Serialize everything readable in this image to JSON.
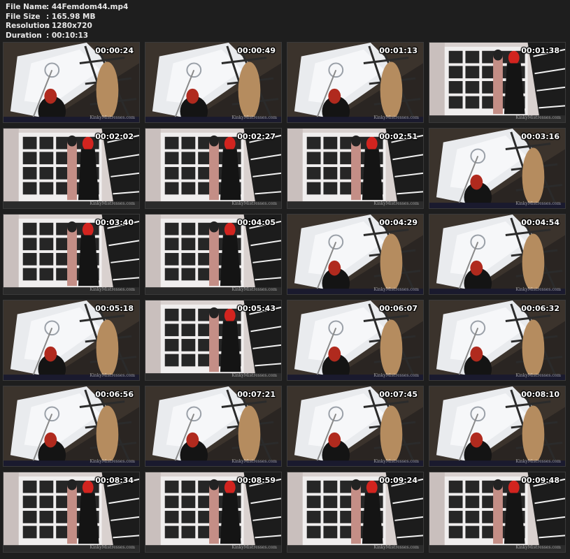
{
  "file_info": [
    {
      "label": "File Name",
      "value": ":  44Femdom44.mp4"
    },
    {
      "label": "File Size",
      "value": ":  165.98 MB"
    },
    {
      "label": "Resolution",
      "value": ":  1280x720"
    },
    {
      "label": "Duration",
      "value": ":  00:10:13"
    }
  ],
  "watermark": "KinkyMistresses.com",
  "thumbnails": [
    {
      "time": "00:00:24",
      "scene": "low"
    },
    {
      "time": "00:00:49",
      "scene": "low"
    },
    {
      "time": "00:01:13",
      "scene": "low"
    },
    {
      "time": "00:01:38",
      "scene": "room"
    },
    {
      "time": "00:02:02",
      "scene": "room"
    },
    {
      "time": "00:02:27",
      "scene": "room"
    },
    {
      "time": "00:02:51",
      "scene": "room"
    },
    {
      "time": "00:03:16",
      "scene": "low"
    },
    {
      "time": "00:03:40",
      "scene": "room"
    },
    {
      "time": "00:04:05",
      "scene": "room"
    },
    {
      "time": "00:04:29",
      "scene": "low"
    },
    {
      "time": "00:04:54",
      "scene": "low"
    },
    {
      "time": "00:05:18",
      "scene": "low"
    },
    {
      "time": "00:05:43",
      "scene": "room"
    },
    {
      "time": "00:06:07",
      "scene": "low"
    },
    {
      "time": "00:06:32",
      "scene": "low"
    },
    {
      "time": "00:06:56",
      "scene": "low"
    },
    {
      "time": "00:07:21",
      "scene": "low"
    },
    {
      "time": "00:07:45",
      "scene": "low"
    },
    {
      "time": "00:08:10",
      "scene": "low"
    },
    {
      "time": "00:08:34",
      "scene": "room"
    },
    {
      "time": "00:08:59",
      "scene": "room"
    },
    {
      "time": "00:09:24",
      "scene": "room"
    },
    {
      "time": "00:09:48",
      "scene": "room"
    }
  ]
}
